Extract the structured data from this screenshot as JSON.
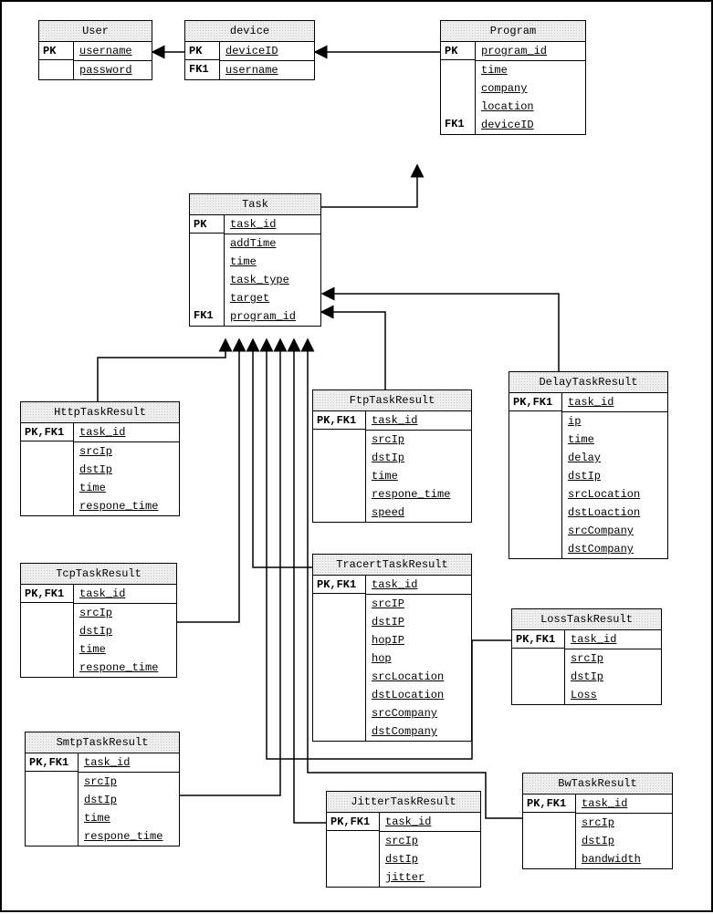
{
  "entities": {
    "user": {
      "title": "User",
      "pk": "PK",
      "fields_pk": [
        "username"
      ],
      "fields": [
        "password"
      ]
    },
    "device": {
      "title": "device",
      "pk": "PK",
      "fk": "FK1",
      "fields_pk": [
        "deviceID"
      ],
      "fields_fk": [
        "username"
      ]
    },
    "program": {
      "title": "Program",
      "pk": "PK",
      "fk": "FK1",
      "fields_pk": [
        "program_id"
      ],
      "fields": [
        "time",
        "company",
        "location"
      ],
      "fields_fk": [
        "deviceID"
      ]
    },
    "task": {
      "title": "Task",
      "pk": "PK",
      "fk": "FK1",
      "fields_pk": [
        "task_id"
      ],
      "fields": [
        "addTime",
        "time",
        "task_type",
        "target"
      ],
      "fields_fk": [
        "program_id"
      ]
    },
    "delay": {
      "title": "DelayTaskResult",
      "pkfk": "PK,FK1",
      "fields_pk": [
        "task_id"
      ],
      "fields": [
        "ip",
        "time",
        "delay",
        "dstIp",
        "srcLocation",
        "dstLoaction",
        "srcCompany",
        "dstCompany"
      ]
    },
    "http": {
      "title": "HttpTaskResult",
      "pkfk": "PK,FK1",
      "fields_pk": [
        "task_id"
      ],
      "fields": [
        "srcIp",
        "dstIp",
        "time",
        "respone_time"
      ]
    },
    "ftp": {
      "title": "FtpTaskResult",
      "pkfk": "PK,FK1",
      "fields_pk": [
        "task_id"
      ],
      "fields": [
        "srcIp",
        "dstIp",
        "time",
        "respone_time",
        "speed"
      ]
    },
    "tcp": {
      "title": "TcpTaskResult",
      "pkfk": "PK,FK1",
      "fields_pk": [
        "task_id"
      ],
      "fields": [
        "srcIp",
        "dstIp",
        "time",
        "respone_time"
      ]
    },
    "tracert": {
      "title": "TracertTaskResult",
      "pkfk": "PK,FK1",
      "fields_pk": [
        "task_id"
      ],
      "fields": [
        "srcIP",
        "dstIP",
        "hopIP",
        "hop",
        "srcLocation",
        "dstLocation",
        "srcCompany",
        "dstCompany"
      ]
    },
    "loss": {
      "title": "LossTaskResult",
      "pkfk": "PK,FK1",
      "fields_pk": [
        "task_id"
      ],
      "fields": [
        "srcIp",
        "dstIp",
        "Loss"
      ]
    },
    "smtp": {
      "title": "SmtpTaskResult",
      "pkfk": "PK,FK1",
      "fields_pk": [
        "task_id"
      ],
      "fields": [
        "srcIp",
        "dstIp",
        "time",
        "respone_time"
      ]
    },
    "jitter": {
      "title": "JitterTaskResult",
      "pkfk": "PK,FK1",
      "fields_pk": [
        "task_id"
      ],
      "fields": [
        "srcIp",
        "dstIp",
        "jitter"
      ]
    },
    "bw": {
      "title": "BwTaskResult",
      "pkfk": "PK,FK1",
      "fields_pk": [
        "task_id"
      ],
      "fields": [
        "srcIp",
        "dstIp",
        "bandwidth"
      ]
    }
  }
}
